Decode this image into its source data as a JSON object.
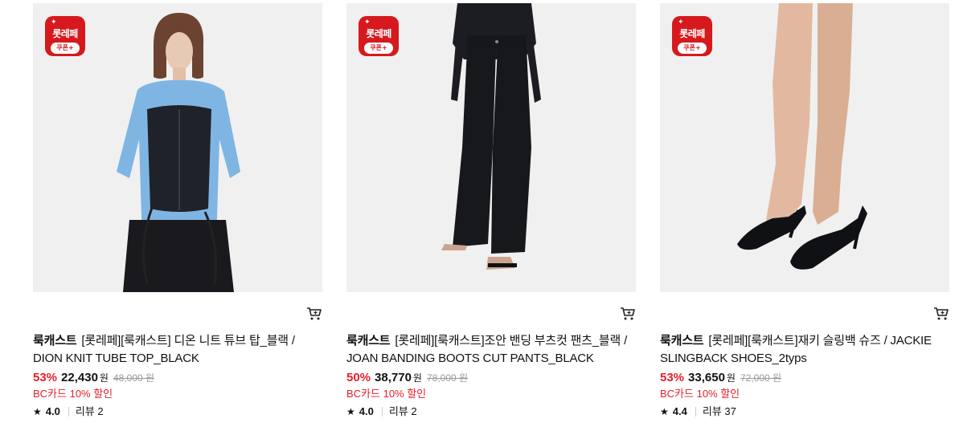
{
  "badge": {
    "brand_text": "롯레페",
    "coupon_text": "쿠폰+",
    "spark": "✦"
  },
  "icons": {
    "cart": "cart-icon",
    "star": "star-icon"
  },
  "colors": {
    "accent": "#e5202a",
    "badge_red": "#d6191d"
  },
  "products": [
    {
      "brand": "룩캐스트",
      "name": "[롯레페][룩캐스트] 디온 니트 튜브 탑_블랙 / DION KNIT TUBE TOP_BLACK",
      "discount": "53%",
      "price": "22,430",
      "currency": "원",
      "original_price": "48,000",
      "original_currency": "원",
      "promo": "BC카드 10% 할인",
      "rating": "4.0",
      "reviews": "리뷰 2"
    },
    {
      "brand": "룩캐스트",
      "name": "[롯레페][룩캐스트]조안 밴딩 부츠컷 팬츠_블랙 / JOAN BANDING BOOTS CUT PANTS_BLACK",
      "discount": "50%",
      "price": "38,770",
      "currency": "원",
      "original_price": "78,000",
      "original_currency": "원",
      "promo": "BC카드 10% 할인",
      "rating": "4.0",
      "reviews": "리뷰 2"
    },
    {
      "brand": "룩캐스트",
      "name": "[롯레페][룩캐스트]재키 슬링백 슈즈 / JACKIE SLINGBACK SHOES_2typs",
      "discount": "53%",
      "price": "33,650",
      "currency": "원",
      "original_price": "72,000",
      "original_currency": "원",
      "promo": "BC카드 10% 할인",
      "rating": "4.4",
      "reviews": "리뷰 37"
    }
  ]
}
